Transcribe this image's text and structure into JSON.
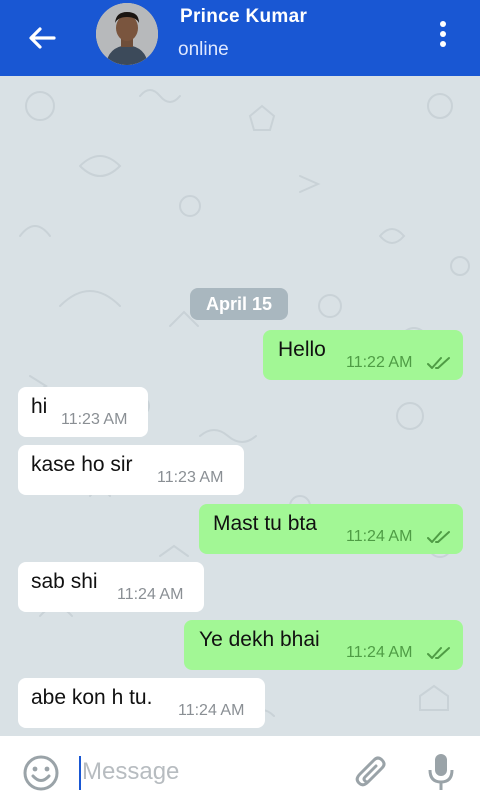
{
  "header": {
    "contact_name": "Prince Kumar",
    "status": "online"
  },
  "chat": {
    "date_chip": "April 15",
    "messages": [
      {
        "direction": "out",
        "text": "Hello",
        "time": "11:22 AM",
        "read": true
      },
      {
        "direction": "in",
        "text": "hi",
        "time": "11:23 AM"
      },
      {
        "direction": "in",
        "text": "kase ho sir",
        "time": "11:23 AM"
      },
      {
        "direction": "out",
        "text": "Mast tu bta",
        "time": "11:24 AM",
        "read": true
      },
      {
        "direction": "in",
        "text": "sab shi",
        "time": "11:24 AM"
      },
      {
        "direction": "out",
        "text": "Ye dekh bhai",
        "time": "11:24 AM",
        "read": true
      },
      {
        "direction": "in",
        "text": "abe kon h tu.",
        "time": "11:24 AM"
      }
    ]
  },
  "composer": {
    "placeholder": "Message"
  },
  "colors": {
    "header": "#1957d3",
    "outgoing_bubble": "#a2f795",
    "incoming_bubble": "#ffffff",
    "chat_background": "#d9e1e5"
  },
  "icons": [
    "back-arrow-icon",
    "more-vert-icon",
    "emoji-icon",
    "attach-icon",
    "mic-icon",
    "double-check-icon"
  ]
}
